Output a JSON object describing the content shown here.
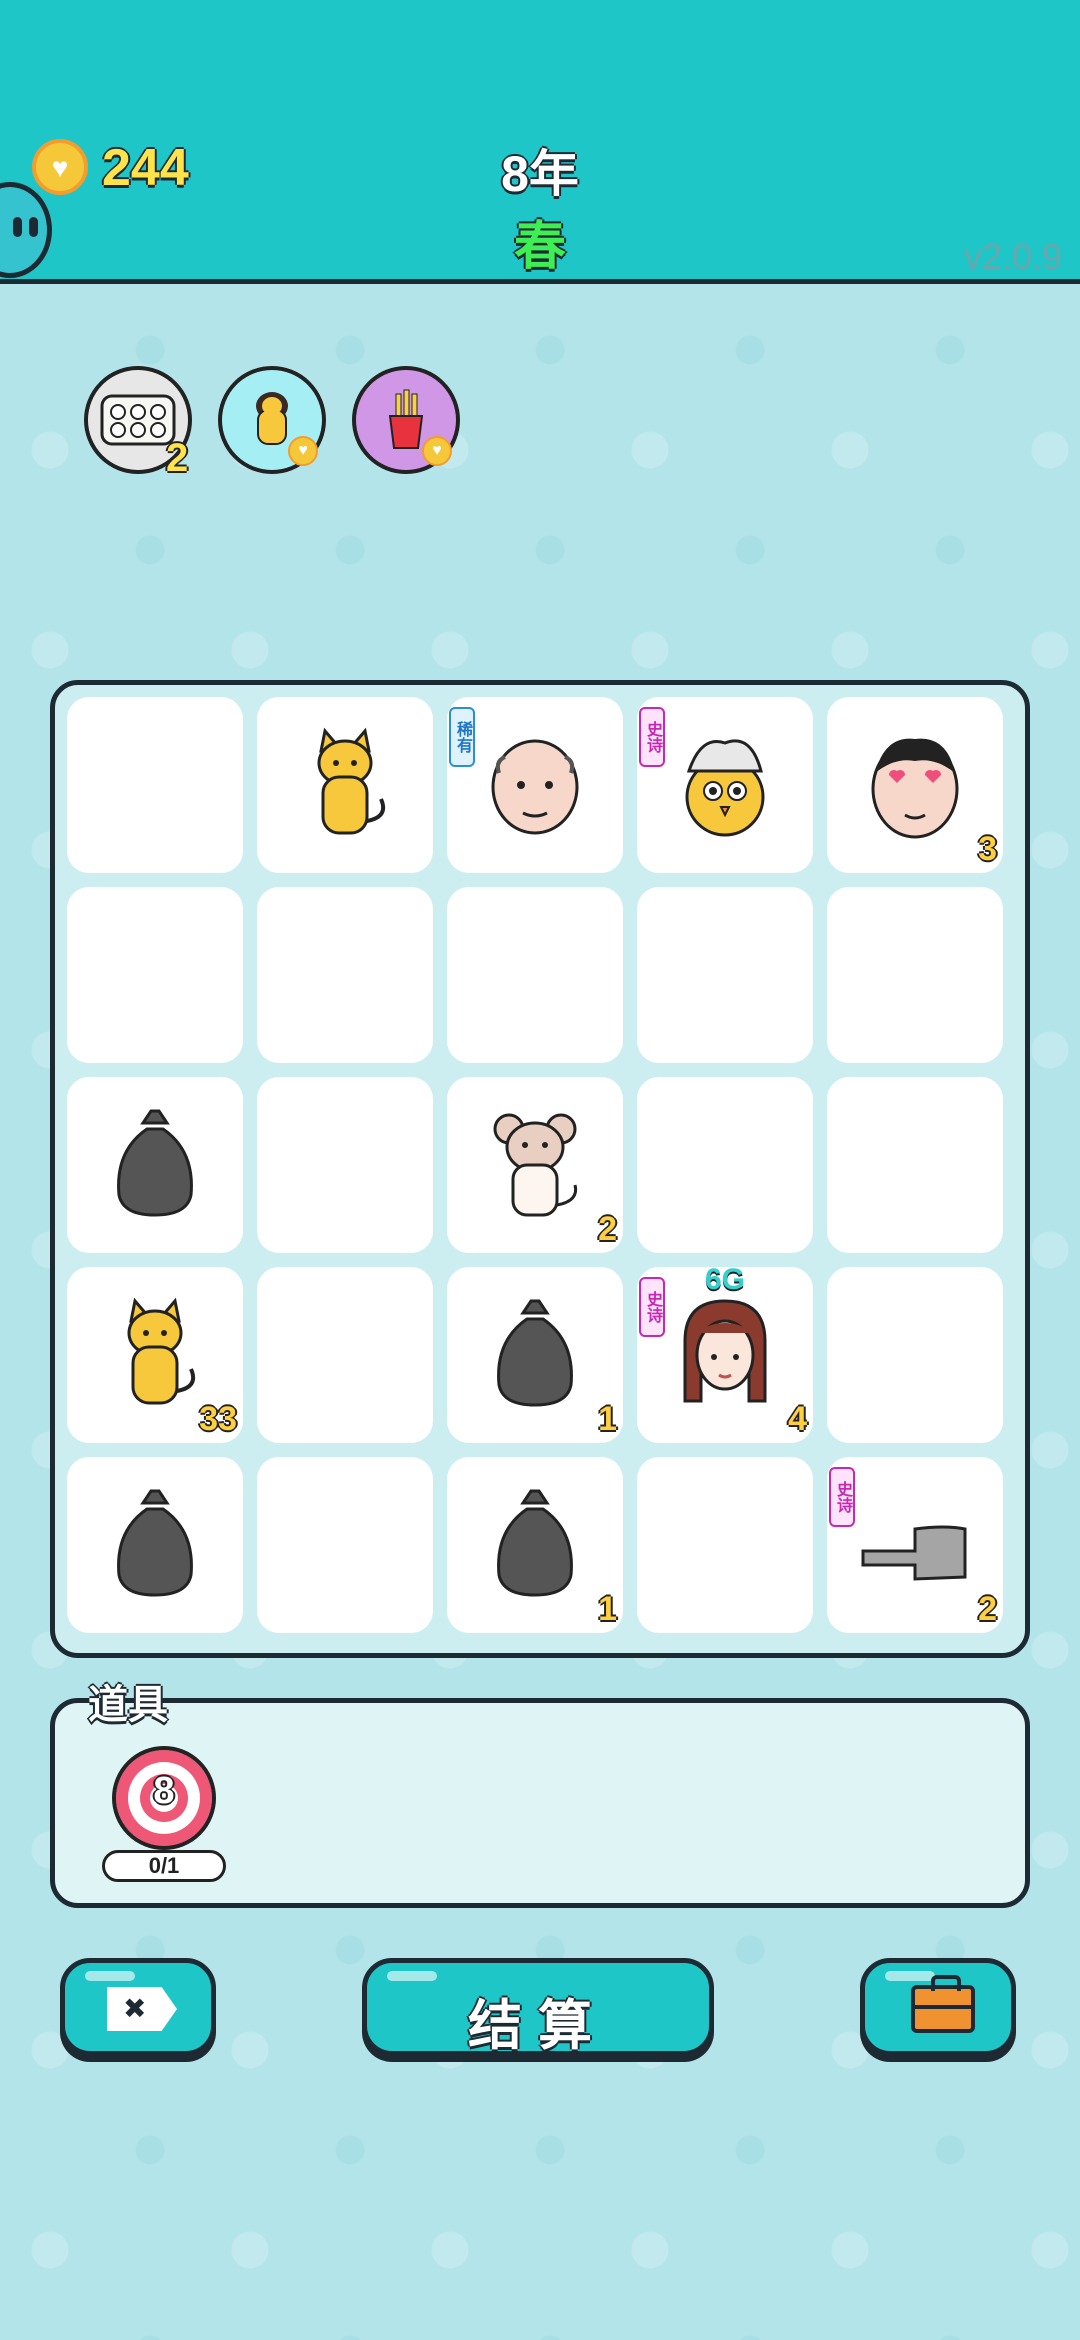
{
  "header": {
    "coins": "244",
    "year": "8年",
    "season": "春",
    "version": "v2.0.9"
  },
  "status_icons": [
    {
      "name": "egg-carton-icon",
      "count": "2"
    },
    {
      "name": "cat-heart-icon"
    },
    {
      "name": "fries-heart-icon"
    }
  ],
  "board": {
    "cells": [
      {
        "row": 0,
        "col": 0
      },
      {
        "row": 0,
        "col": 1,
        "icon": "yellow-cat-icon"
      },
      {
        "row": 0,
        "col": 2,
        "icon": "bald-old-man-icon",
        "tag": "稀有"
      },
      {
        "row": 0,
        "col": 3,
        "icon": "chick-grey-hair-icon",
        "tag": "史诗"
      },
      {
        "row": 0,
        "col": 4,
        "icon": "lovestruck-man-icon",
        "count": "3"
      },
      {
        "row": 1,
        "col": 0
      },
      {
        "row": 1,
        "col": 1
      },
      {
        "row": 1,
        "col": 2
      },
      {
        "row": 1,
        "col": 3
      },
      {
        "row": 1,
        "col": 4
      },
      {
        "row": 2,
        "col": 0,
        "icon": "garbage-bag-icon"
      },
      {
        "row": 2,
        "col": 1
      },
      {
        "row": 2,
        "col": 2,
        "icon": "mouse-icon",
        "count": "2"
      },
      {
        "row": 2,
        "col": 3
      },
      {
        "row": 2,
        "col": 4
      },
      {
        "row": 3,
        "col": 0,
        "icon": "yellow-cat-icon",
        "count": "33"
      },
      {
        "row": 3,
        "col": 1
      },
      {
        "row": 3,
        "col": 2,
        "icon": "garbage-bag-icon",
        "count": "1"
      },
      {
        "row": 3,
        "col": 3,
        "icon": "girl-braids-icon",
        "tag": "史诗",
        "label": "6G",
        "count": "4"
      },
      {
        "row": 3,
        "col": 4
      },
      {
        "row": 4,
        "col": 0,
        "icon": "garbage-bag-icon"
      },
      {
        "row": 4,
        "col": 1
      },
      {
        "row": 4,
        "col": 2,
        "icon": "garbage-bag-icon",
        "count": "1"
      },
      {
        "row": 4,
        "col": 3
      },
      {
        "row": 4,
        "col": 4,
        "icon": "pointing-hand-icon",
        "tag": "史诗",
        "count": "2"
      }
    ]
  },
  "items": {
    "title": "道具",
    "target_number": "8",
    "usage": "0/1"
  },
  "buttons": {
    "settle": "结算"
  },
  "colors": {
    "header_bg": "#1ec6c8",
    "coin_text": "#ffe34a",
    "season_text": "#3dee54",
    "tag_rare": "#1f76c8",
    "tag_epic": "#c528b5"
  }
}
